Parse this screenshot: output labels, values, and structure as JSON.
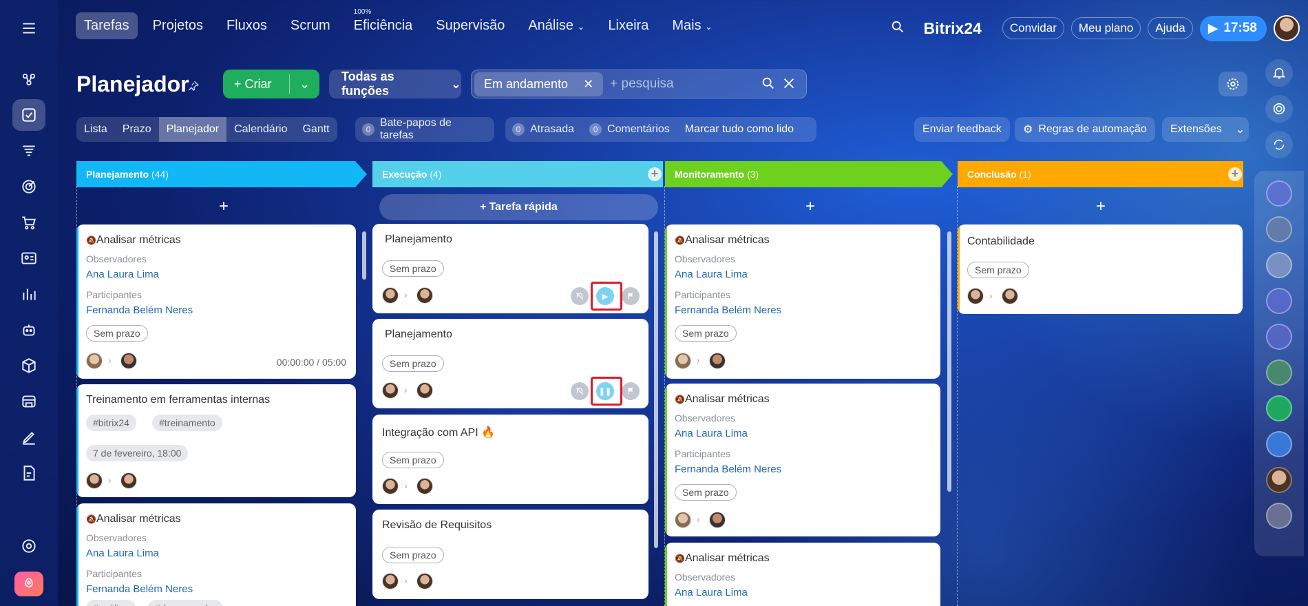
{
  "topnav": {
    "tabs": [
      "Tarefas",
      "Projetos",
      "Fluxos",
      "Scrum",
      "Eficiência",
      "Supervisão",
      "Análise",
      "Lixeira",
      "Mais"
    ],
    "efficiency_badge": "100%",
    "brand": "Bitrix24",
    "invite": "Convidar",
    "plan": "Meu plano",
    "help": "Ajuda",
    "clock": "17:58"
  },
  "toolbar": {
    "title": "Planejador",
    "create": "Criar",
    "roles": "Todas as funções",
    "filter_chip": "Em andamento",
    "search_placeholder": "+ pesquisa"
  },
  "views": [
    "Lista",
    "Prazo",
    "Planejador",
    "Calendário",
    "Gantt"
  ],
  "counters": {
    "chats_count": "0",
    "chats_label": "Bate-papos de tarefas",
    "overdue_count": "0",
    "overdue_label": "Atrasada",
    "comments_count": "0",
    "comments_label": "Comentários",
    "mark_read": "Marcar tudo como lido"
  },
  "right_actions": {
    "feedback": "Enviar feedback",
    "automation": "Regras de automação",
    "extensions": "Extensões"
  },
  "columns": [
    {
      "title": "Planejamento",
      "count": "(44)",
      "color": "#12b8f5"
    },
    {
      "title": "Execução",
      "count": "(4)",
      "color": "#55d0ea"
    },
    {
      "title": "Monitoramento",
      "count": "(3)",
      "color": "#6ed11e"
    },
    {
      "title": "Conclusão",
      "count": "(1)",
      "color": "#ffa900"
    }
  ],
  "quick_task": "Tarefa rápida",
  "labels": {
    "observers": "Observadores",
    "participants": "Participantes",
    "no_deadline": "Sem prazo",
    "observer_name": "Ana Laura Lima",
    "participant_name": "Fernanda Belém Neres"
  },
  "cards": {
    "plan1_title": "Analisar métricas",
    "plan1_timer": "00:00:00 / 05:00",
    "plan2_title": "Treinamento em ferramentas internas",
    "plan2_tag1": "#bitrix24",
    "plan2_tag2": "#treinamento",
    "plan2_date": "7 de fevereiro, 18:00",
    "plan3_title": "Analisar métricas",
    "plan3_tag1": "#análise",
    "plan3_tag2": "#desempenho",
    "exec1_title": "Planejamento",
    "exec2_title": "Planejamento",
    "exec3_title": "Integração com API",
    "exec4_title": "Revisão de Requisitos",
    "mon1_title": "Analisar métricas",
    "mon2_title": "Analisar métricas",
    "mon3_title": "Analisar métricas",
    "done1_title": "Contabilidade"
  },
  "icons": {
    "menu": "hamburger-icon",
    "tasks": "checkbox-icon",
    "search": "search-icon",
    "settings": "gear-icon",
    "bell": "bell-icon",
    "play": "play-icon",
    "pause": "pause-icon"
  }
}
